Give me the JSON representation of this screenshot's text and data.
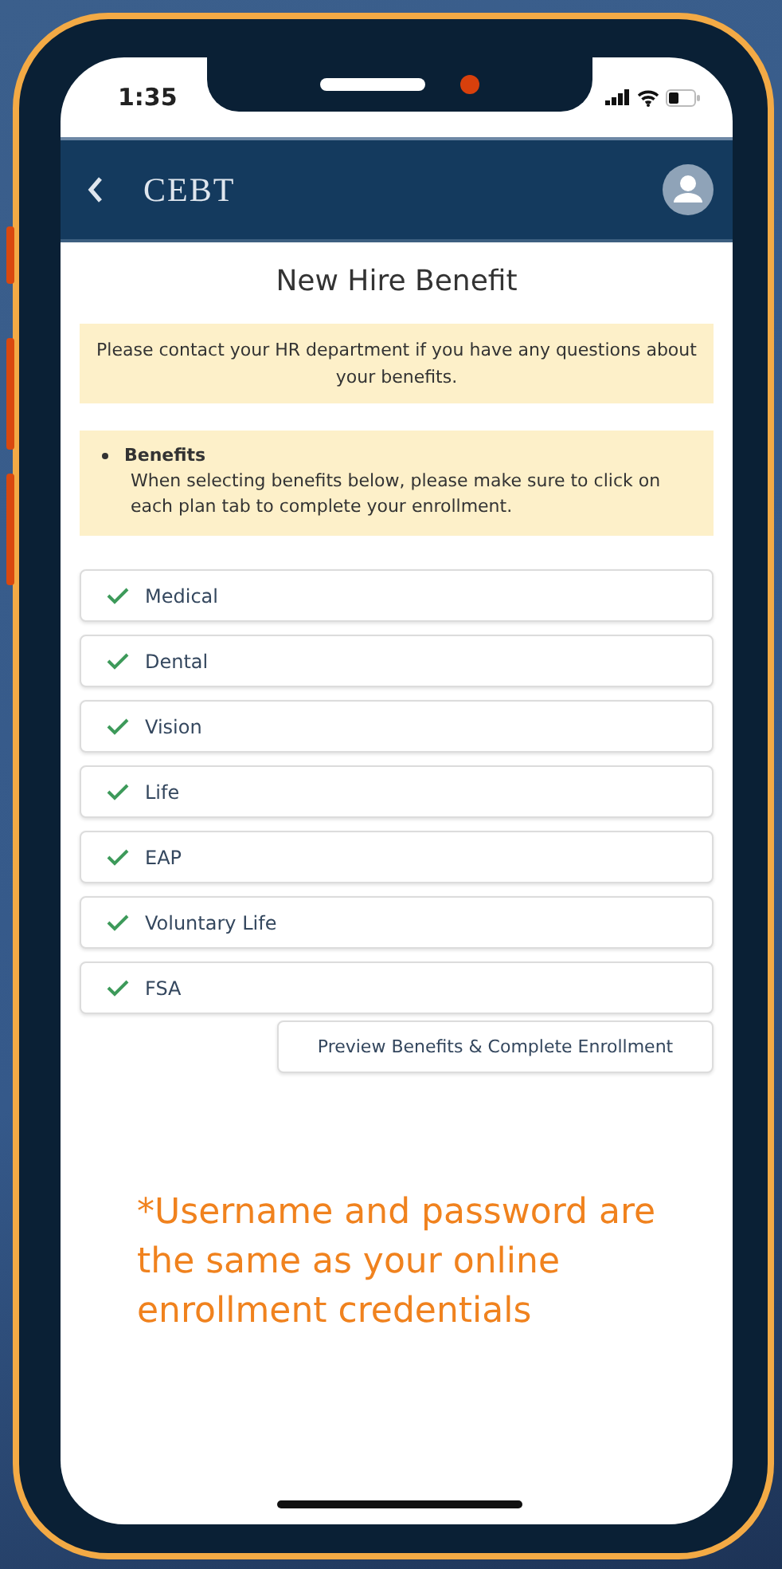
{
  "status_bar": {
    "time": "1:35"
  },
  "app_bar": {
    "title": "CEBT"
  },
  "page_title": "New Hire Benefit",
  "notice": "Please contact your HR department if you have any questions about your benefits.",
  "info": {
    "heading": "Benefits",
    "text": "When selecting benefits below, please make sure to click on each plan tab to complete your enrollment."
  },
  "plans": [
    {
      "label": "Medical",
      "checked": true
    },
    {
      "label": "Dental",
      "checked": true
    },
    {
      "label": "Vision",
      "checked": true
    },
    {
      "label": "Life",
      "checked": true
    },
    {
      "label": "EAP",
      "checked": true
    },
    {
      "label": "Voluntary Life",
      "checked": true
    },
    {
      "label": "FSA",
      "checked": true
    }
  ],
  "action_button": "Preview Benefits & Complete Enrollment",
  "footnote": "*Username and password are the same as your online enrollment credentials"
}
